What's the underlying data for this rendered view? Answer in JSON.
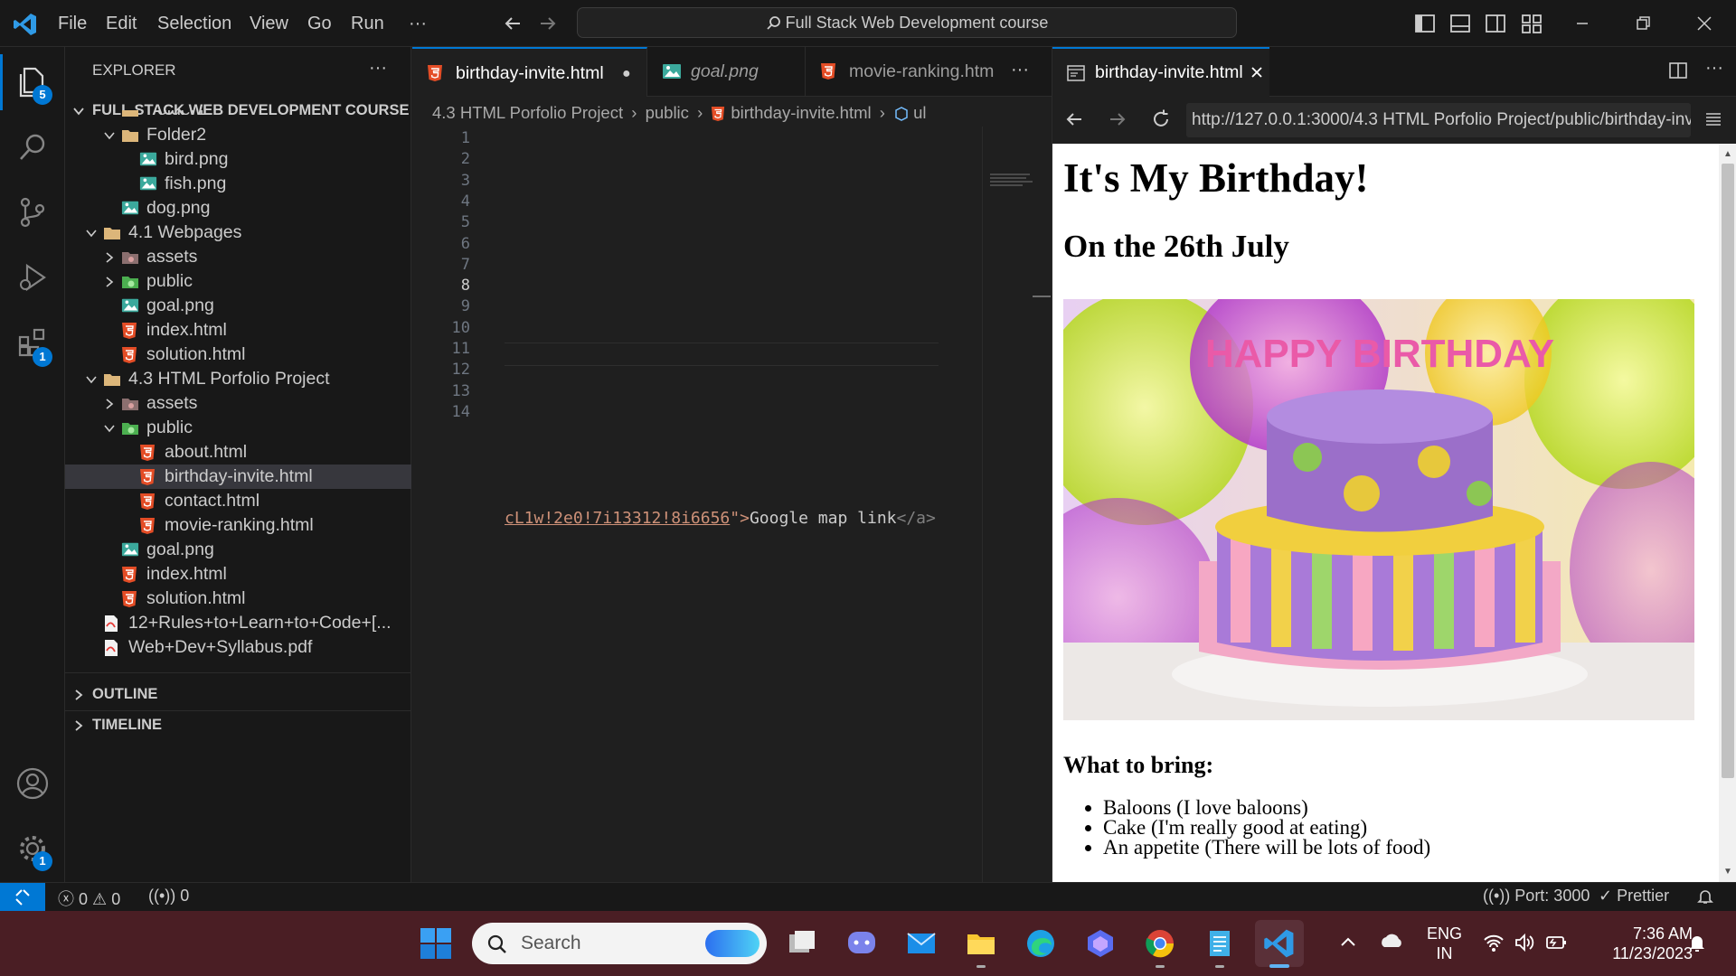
{
  "window": {
    "menu": [
      "File",
      "Edit",
      "Selection",
      "View",
      "Go",
      "Run"
    ],
    "more": "···",
    "command_center": "Full Stack Web Development course",
    "badges": {
      "explorer": "5",
      "extensions": "1",
      "settings": "1"
    }
  },
  "sidebar": {
    "title": "EXPLORER",
    "more": "···",
    "root": "FULL STACK WEB DEVELOPMENT COURSE",
    "items": [
      {
        "label": "Folder1"
      },
      {
        "label": "Folder2"
      },
      {
        "label": "bird.png"
      },
      {
        "label": "fish.png"
      },
      {
        "label": "dog.png"
      },
      {
        "label": "4.1 Webpages"
      },
      {
        "label": "assets"
      },
      {
        "label": "public"
      },
      {
        "label": "goal.png"
      },
      {
        "label": "index.html"
      },
      {
        "label": "solution.html"
      },
      {
        "label": "4.3 HTML Porfolio Project"
      },
      {
        "label": "assets"
      },
      {
        "label": "public"
      },
      {
        "label": "about.html"
      },
      {
        "label": "birthday-invite.html"
      },
      {
        "label": "contact.html"
      },
      {
        "label": "movie-ranking.html"
      },
      {
        "label": "goal.png"
      },
      {
        "label": "index.html"
      },
      {
        "label": "solution.html"
      },
      {
        "label": "12+Rules+to+Learn+to+Code+[..."
      },
      {
        "label": "Web+Dev+Syllabus.pdf"
      }
    ],
    "outline": "OUTLINE",
    "timeline": "TIMELINE"
  },
  "editor": {
    "tabs": [
      {
        "label": "birthday-invite.html",
        "dirty": "●"
      },
      {
        "label": "goal.png"
      },
      {
        "label": "movie-ranking.htm"
      }
    ],
    "tabs_more": "···",
    "breadcrumb": [
      "4.3 HTML Porfolio Project",
      "public",
      "birthday-invite.html",
      "ul"
    ],
    "line_numbers": [
      "1",
      "2",
      "3",
      "4",
      "5",
      "6",
      "7",
      "8",
      "9",
      "10",
      "11",
      "12",
      "13",
      "14"
    ],
    "code_line14": {
      "url_tail": "cL1w!2e0!7i13312!8i6656",
      "quote": "\">",
      "text": "Google map link",
      "close": "</a>"
    }
  },
  "preview": {
    "tab_label": "birthday-invite.html",
    "url": "http://127.0.0.1:3000/4.3 HTML Porfolio Project/public/birthday-invite.html",
    "page": {
      "h1": "It's My Birthday!",
      "h2": "On the 26th July",
      "cake_text": "HAPPY BIRTHDAY",
      "h3": "What to bring:",
      "list": [
        "Baloons (I love baloons)",
        "Cake (I'm really good at eating)",
        "An appetite (There will be lots of food)"
      ]
    }
  },
  "status": {
    "errors": "0",
    "warnings": "0",
    "ports": "0",
    "port": "Port: 3000",
    "prettier": "Prettier"
  },
  "taskbar": {
    "search": "Search",
    "lang_1": "ENG",
    "lang_2": "IN",
    "time": "7:36 AM",
    "date": "11/23/2023"
  }
}
